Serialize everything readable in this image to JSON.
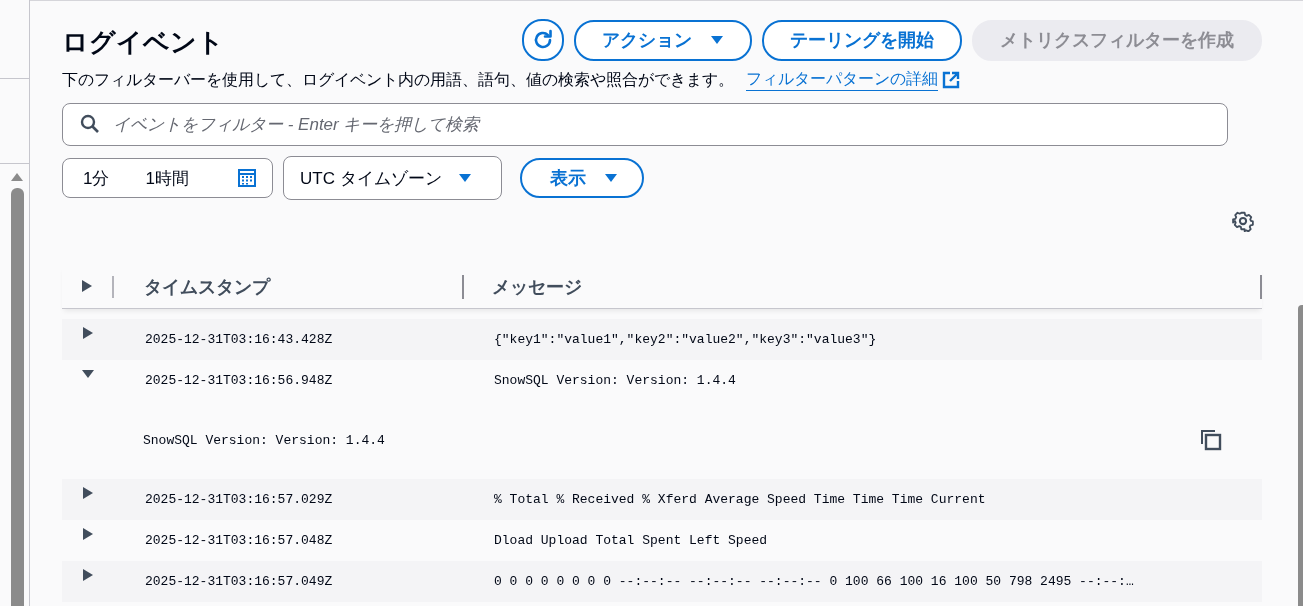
{
  "title": "ログイベント",
  "buttons": [
    {
      "kind": "refresh",
      "disabled": false
    },
    {
      "kind": "dropdown",
      "label": "アクション",
      "disabled": false
    },
    {
      "kind": "plain",
      "label": "テーリングを開始",
      "disabled": false
    },
    {
      "kind": "plain",
      "label": "メトリクスフィルターを作成",
      "disabled": true
    }
  ],
  "description": "下のフィルターバーを使用して、ログイベント内の用語、語句、値の検索や照合ができます。",
  "help_link": "フィルターパターンの詳細",
  "search": {
    "placeholder": "イベントをフィルター - Enter キーを押して検索"
  },
  "time_range": [
    "1分",
    "1時間"
  ],
  "timezone": "UTC タイムゾーン",
  "display_button": "表示",
  "expand_all": {
    "expanded": false
  },
  "columns": [
    "タイムスタンプ",
    "メッセージ"
  ],
  "rows": [
    {
      "timestamp": "2025-12-31T03:16:43.428Z",
      "message": "{\"key1\":\"value1\",\"key2\":\"value2\",\"key3\":\"value3\"}",
      "expanded": false
    },
    {
      "timestamp": "2025-12-31T03:16:56.948Z",
      "message": "SnowSQL Version: Version: 1.4.4",
      "expanded": true,
      "detail": "SnowSQL Version: Version: 1.4.4"
    },
    {
      "timestamp": "2025-12-31T03:16:57.029Z",
      "message": "% Total % Received % Xferd Average Speed Time Time Time Current",
      "expanded": false
    },
    {
      "timestamp": "2025-12-31T03:16:57.048Z",
      "message": "Dload Upload Total Spent Left Speed",
      "expanded": false
    },
    {
      "timestamp": "2025-12-31T03:16:57.049Z",
      "message": "0 0 0 0 0 0 0 0 --:--:-- --:--:-- --:--:-- 0 100 66 100 16 100 50 798 2495 --:--:…",
      "expanded": false
    }
  ]
}
